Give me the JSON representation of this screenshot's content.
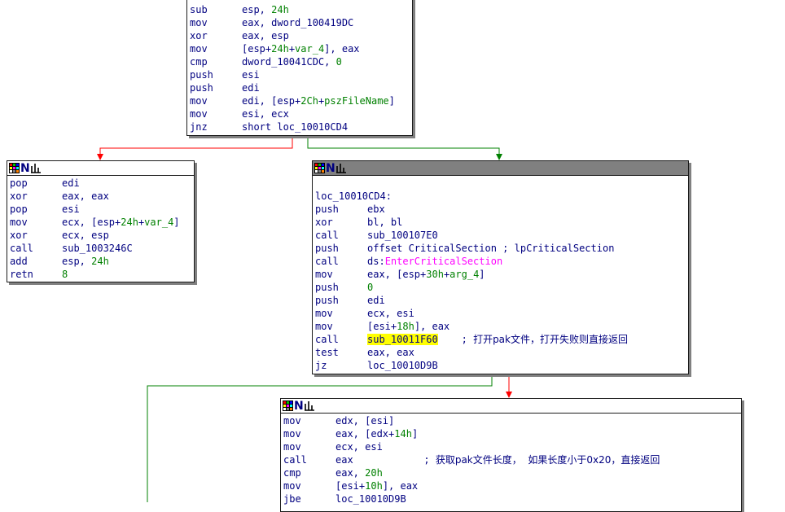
{
  "colors": {
    "true_edge": "#008000",
    "false_edge": "#ff0000",
    "text": "#000080",
    "number": "#008000",
    "api": "#ff00ff",
    "highlight": "#ffff00"
  },
  "header_icons": [
    "color-grid-icon",
    "n-letter-icon",
    "chart-icon"
  ],
  "header_n_glyph": "N",
  "nodes": [
    {
      "id": "node-entry",
      "lines": [
        [
          {
            "t": "sub",
            "c": "mn"
          },
          {
            "t": "esp, "
          },
          {
            "t": "24h",
            "c": "num"
          }
        ],
        [
          {
            "t": "mov",
            "c": "mn"
          },
          {
            "t": "eax, dword_100419DC"
          }
        ],
        [
          {
            "t": "xor",
            "c": "mn"
          },
          {
            "t": "eax, esp"
          }
        ],
        [
          {
            "t": "mov",
            "c": "mn"
          },
          {
            "t": "[esp+"
          },
          {
            "t": "24h",
            "c": "num"
          },
          {
            "t": "+"
          },
          {
            "t": "var_4",
            "c": "num"
          },
          {
            "t": "], eax"
          }
        ],
        [
          {
            "t": "cmp",
            "c": "mn"
          },
          {
            "t": "dword_10041CDC, "
          },
          {
            "t": "0",
            "c": "num"
          }
        ],
        [
          {
            "t": "push",
            "c": "mn"
          },
          {
            "t": "esi"
          }
        ],
        [
          {
            "t": "push",
            "c": "mn"
          },
          {
            "t": "edi"
          }
        ],
        [
          {
            "t": "mov",
            "c": "mn"
          },
          {
            "t": "edi, [esp+"
          },
          {
            "t": "2Ch",
            "c": "num"
          },
          {
            "t": "+"
          },
          {
            "t": "pszFileName",
            "c": "num"
          },
          {
            "t": "]"
          }
        ],
        [
          {
            "t": "mov",
            "c": "mn"
          },
          {
            "t": "esi, ecx"
          }
        ],
        [
          {
            "t": "jnz",
            "c": "mn"
          },
          {
            "t": "short loc_10010CD4"
          }
        ]
      ]
    },
    {
      "id": "node-fail-return",
      "lines": [
        [
          {
            "t": "pop",
            "c": "mn"
          },
          {
            "t": "edi"
          }
        ],
        [
          {
            "t": "xor",
            "c": "mn"
          },
          {
            "t": "eax, eax"
          }
        ],
        [
          {
            "t": "pop",
            "c": "mn"
          },
          {
            "t": "esi"
          }
        ],
        [
          {
            "t": "mov",
            "c": "mn"
          },
          {
            "t": "ecx, [esp+"
          },
          {
            "t": "24h",
            "c": "num"
          },
          {
            "t": "+"
          },
          {
            "t": "var_4",
            "c": "num"
          },
          {
            "t": "]"
          }
        ],
        [
          {
            "t": "xor",
            "c": "mn"
          },
          {
            "t": "ecx, esp"
          }
        ],
        [
          {
            "t": "call",
            "c": "mn"
          },
          {
            "t": "sub_1003246C"
          }
        ],
        [
          {
            "t": "add",
            "c": "mn"
          },
          {
            "t": "esp, "
          },
          {
            "t": "24h",
            "c": "num"
          }
        ],
        [
          {
            "t": "retn",
            "c": "mn"
          },
          {
            "t": "8",
            "c": "num"
          }
        ]
      ]
    },
    {
      "id": "node-loc-10010cd4",
      "lines": [
        [],
        [
          {
            "t": "loc_10010CD4:"
          }
        ],
        [
          {
            "t": "push",
            "c": "mn"
          },
          {
            "t": "ebx"
          }
        ],
        [
          {
            "t": "xor",
            "c": "mn"
          },
          {
            "t": "bl, bl"
          }
        ],
        [
          {
            "t": "call",
            "c": "mn"
          },
          {
            "t": "sub_100107E0"
          }
        ],
        [
          {
            "t": "push",
            "c": "mn"
          },
          {
            "t": "offset CriticalSection ; lpCriticalSection"
          }
        ],
        [
          {
            "t": "call",
            "c": "mn"
          },
          {
            "t": "ds:"
          },
          {
            "t": "EnterCriticalSection",
            "c": "api"
          }
        ],
        [
          {
            "t": "mov",
            "c": "mn"
          },
          {
            "t": "eax, [esp+"
          },
          {
            "t": "30h",
            "c": "num"
          },
          {
            "t": "+"
          },
          {
            "t": "arg_4",
            "c": "num"
          },
          {
            "t": "]"
          }
        ],
        [
          {
            "t": "push",
            "c": "mn"
          },
          {
            "t": "0",
            "c": "num"
          }
        ],
        [
          {
            "t": "push",
            "c": "mn"
          },
          {
            "t": "edi"
          }
        ],
        [
          {
            "t": "mov",
            "c": "mn"
          },
          {
            "t": "ecx, esi"
          }
        ],
        [
          {
            "t": "mov",
            "c": "mn"
          },
          {
            "t": "[esi+"
          },
          {
            "t": "18h",
            "c": "num"
          },
          {
            "t": "], eax"
          }
        ],
        [
          {
            "t": "call",
            "c": "mn"
          },
          {
            "t": "sub_10011F60",
            "c": "hl"
          },
          {
            "t": "    ; "
          },
          {
            "t": "打开pak文件，打开失败则直接返回",
            "c": "cmt"
          }
        ],
        [
          {
            "t": "test",
            "c": "mn"
          },
          {
            "t": "eax, eax"
          }
        ],
        [
          {
            "t": "jz",
            "c": "mn"
          },
          {
            "t": "loc_10010D9B"
          }
        ]
      ]
    },
    {
      "id": "node-get-length",
      "lines": [
        [
          {
            "t": "mov",
            "c": "mn"
          },
          {
            "t": "edx, [esi]"
          }
        ],
        [
          {
            "t": "mov",
            "c": "mn"
          },
          {
            "t": "eax, [edx+"
          },
          {
            "t": "14h",
            "c": "num"
          },
          {
            "t": "]"
          }
        ],
        [
          {
            "t": "mov",
            "c": "mn"
          },
          {
            "t": "ecx, esi"
          }
        ],
        [
          {
            "t": "call",
            "c": "mn"
          },
          {
            "t": "eax            ; "
          },
          {
            "t": "获取pak文件长度，  如果长度小于0x20，直接返回",
            "c": "cmt"
          }
        ],
        [
          {
            "t": "cmp",
            "c": "mn"
          },
          {
            "t": "eax, "
          },
          {
            "t": "20h",
            "c": "num"
          }
        ],
        [
          {
            "t": "mov",
            "c": "mn"
          },
          {
            "t": "[esi+"
          },
          {
            "t": "10h",
            "c": "num"
          },
          {
            "t": "], eax"
          }
        ],
        [
          {
            "t": "jbe",
            "c": "mn"
          },
          {
            "t": "loc_10010D9B"
          }
        ]
      ]
    }
  ]
}
